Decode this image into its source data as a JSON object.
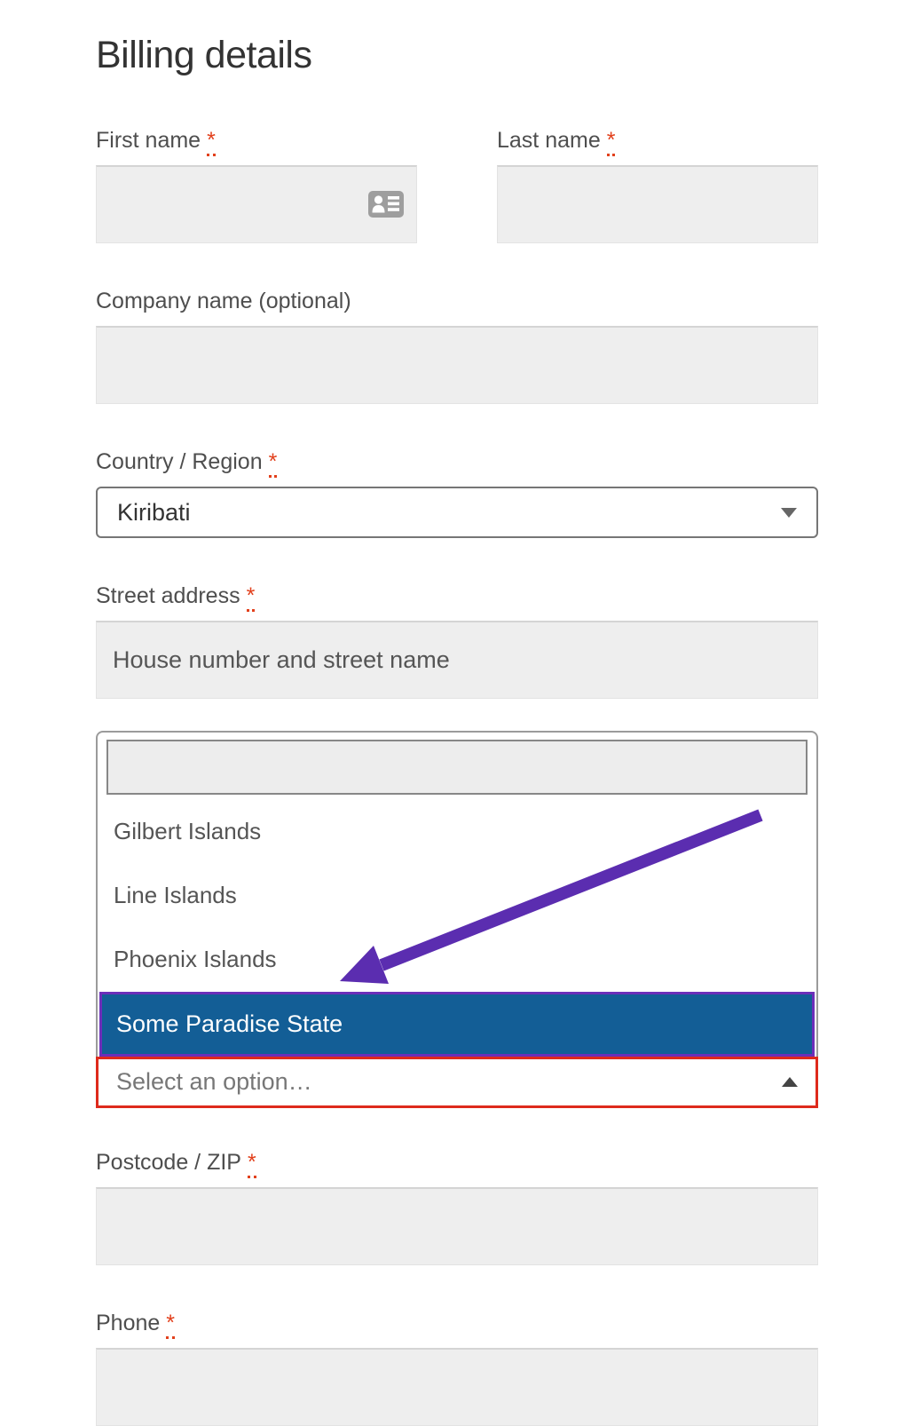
{
  "page": {
    "heading": "Billing details"
  },
  "required_marker": "*",
  "fields": {
    "first_name": {
      "label": "First name",
      "required": true,
      "value": ""
    },
    "last_name": {
      "label": "Last name",
      "required": true,
      "value": ""
    },
    "company": {
      "label": "Company name (optional)",
      "required": false,
      "value": ""
    },
    "country": {
      "label": "Country / Region",
      "required": true,
      "value": "Kiribati"
    },
    "street_address": {
      "label": "Street address",
      "required": true,
      "placeholder": "House number and street name",
      "value": ""
    },
    "postcode": {
      "label": "Postcode / ZIP",
      "required": true,
      "value": ""
    },
    "phone": {
      "label": "Phone",
      "required": true,
      "value": ""
    }
  },
  "state_dropdown": {
    "search_value": "",
    "options": [
      {
        "label": "Gilbert Islands"
      },
      {
        "label": "Line Islands"
      },
      {
        "label": "Phoenix Islands"
      },
      {
        "label": "Some Paradise State"
      }
    ],
    "highlighted_option": "Some Paradise State",
    "control_placeholder": "Select an option…"
  },
  "icons": {
    "first_name_field": "contact-card-icon",
    "country_select": "chevron-down-icon",
    "state_select": "chevron-up-icon",
    "annotation": "purple-arrow-icon"
  },
  "colors": {
    "highlight_background": "#135e96",
    "highlight_border": "#6c2eb9",
    "error_border": "#de2a1c",
    "annotation_arrow": "#5b2db0",
    "required_marker": "#e2401c",
    "input_background": "#eeeeee"
  }
}
